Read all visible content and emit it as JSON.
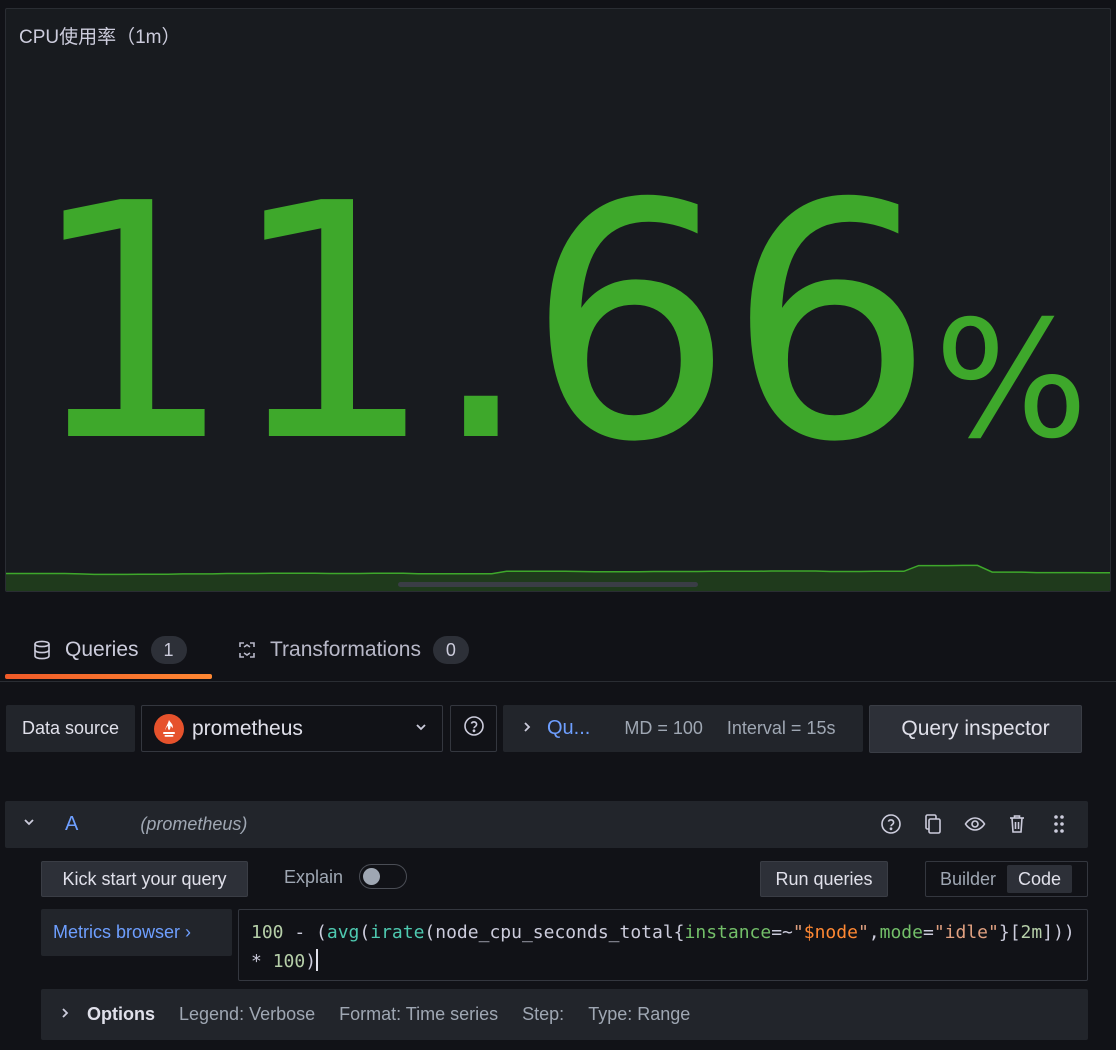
{
  "panel": {
    "title": "CPU使用率（1m）",
    "stat_value": "11.66",
    "stat_unit": "%",
    "stat_color": "#3ea82b",
    "sparkline": [
      2,
      2,
      2,
      2,
      2,
      1.8,
      1.6,
      1.6,
      1.6,
      1.7,
      1.7,
      1.7,
      1.8,
      1.8,
      1.8,
      2,
      2,
      2,
      2.1,
      2.1,
      2.1,
      2.1,
      2,
      2,
      2,
      2.1,
      2.1,
      2.1,
      1.9,
      1.9,
      1.9,
      1.9,
      1.9,
      1.9,
      3,
      3,
      3,
      3,
      3,
      2.9,
      2.8,
      2.8,
      2.8,
      2.8,
      2.9,
      2.9,
      2.9,
      2.9,
      3,
      3,
      3,
      3,
      3.1,
      3.1,
      3.1,
      3.1,
      2.9,
      2.9,
      2.9,
      3,
      3,
      3,
      5.5,
      5.5,
      5.5,
      5.6,
      5.6,
      2.6,
      2.6,
      2.6,
      2.4,
      2.4,
      2.4,
      2.4,
      2.3,
      2.3
    ]
  },
  "tabs": [
    {
      "label": "Queries",
      "count": "1",
      "icon": "database-icon"
    },
    {
      "label": "Transformations",
      "count": "0",
      "icon": "transform-icon"
    }
  ],
  "datasource": {
    "label": "Data source",
    "selected": "prometheus",
    "query_options_short": "Qu...",
    "max_data_points": "MD = 100",
    "interval": "Interval = 15s",
    "inspector_label": "Query inspector"
  },
  "query": {
    "ref_id": "A",
    "datasource_hint": "(prometheus)",
    "kick_start_label": "Kick start your query",
    "explain_label": "Explain",
    "explain_on": false,
    "run_label": "Run queries",
    "modes": [
      "Builder",
      "Code"
    ],
    "active_mode": "Code",
    "metrics_browser_label": "Metrics browser ›",
    "expr": "100 - (avg(irate(node_cpu_seconds_total{instance=~\"$node\",mode=\"idle\"}[2m])) * 100)",
    "options": {
      "title": "Options",
      "legend": "Legend: Verbose",
      "format": "Format: Time series",
      "step": "Step:",
      "type": "Type: Range"
    }
  }
}
